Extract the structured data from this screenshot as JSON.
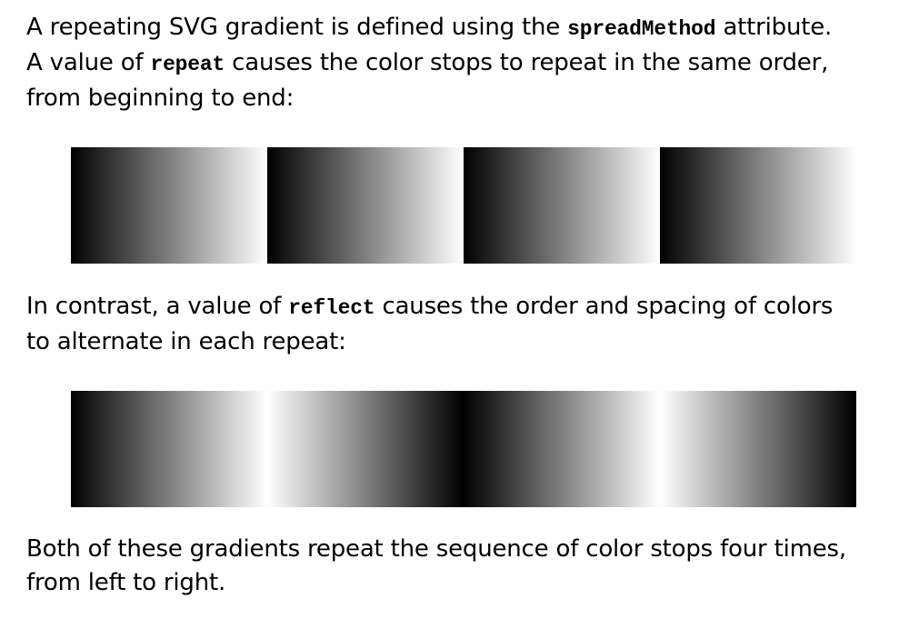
{
  "paragraph_1": {
    "line_1_a": "A repeating SVG gradient is defined using the ",
    "line_1_code": "spreadMethod",
    "line_1_b": " attribute.",
    "line_2_a": "A value of ",
    "line_2_code": "repeat",
    "line_2_b": " causes the color stops to repeat in the same order,",
    "line_3": "from beginning to end:"
  },
  "paragraph_2": {
    "line_1_a": "In contrast, a value of ",
    "line_1_code": "reflect",
    "line_1_b": " causes the order and spacing of colors",
    "line_2": "to alternate in each repeat:"
  },
  "paragraph_3": {
    "line_1": "Both of these gradients repeat the sequence of color stops four times,",
    "line_2": "from left to right."
  },
  "gradients": {
    "repetitions": 4,
    "color_start": "#000000",
    "color_end": "#ffffff",
    "repeat_gradient": {
      "spread_method": "repeat"
    },
    "reflect_gradient": {
      "spread_method": "reflect"
    }
  }
}
